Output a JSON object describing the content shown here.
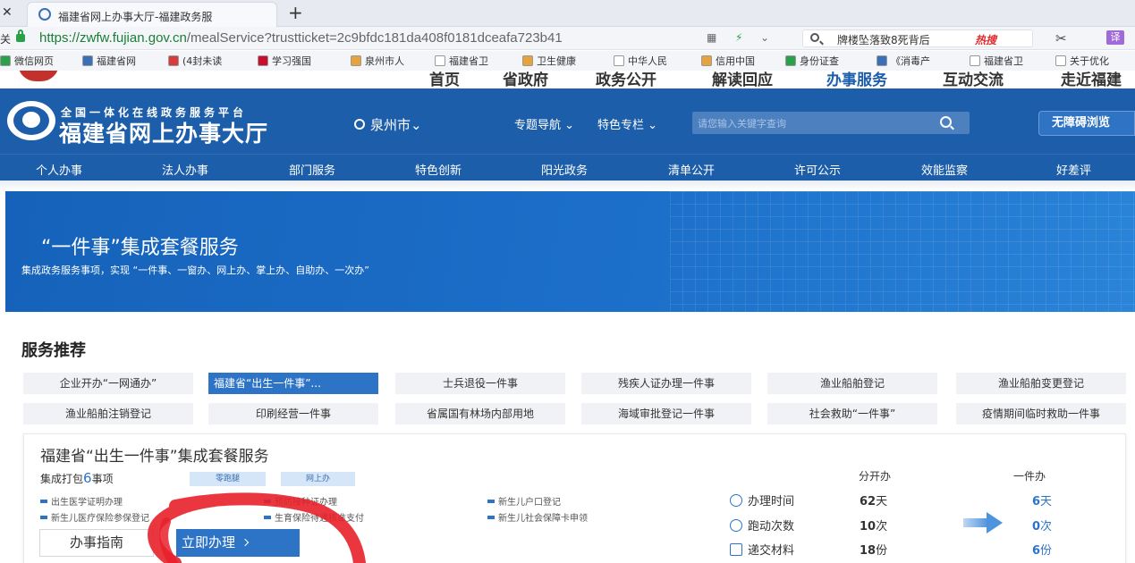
{
  "browser": {
    "tab_title": "福建省网上办事大厅-福建政务服",
    "new_tab": "+",
    "left_glyph": "关",
    "url_host": "https://zwfw.fujian.gov.cn",
    "url_path": "/mealService?trustticket=2c9bfdc181da408f0181dceafa723b41",
    "search_query": "牌楼坠落致8死背后",
    "search_hot": "热搜",
    "translate_label": "译",
    "bookmarks": [
      "微信网页",
      "福建省网",
      "(4封未读",
      "学习强国",
      "泉州市人",
      "福建省卫",
      "卫生健康",
      "中华人民",
      "信用中国",
      "身份证查",
      "《消毒产",
      "福建省卫",
      "关于优化"
    ]
  },
  "site": {
    "top_strip": [
      "首页",
      "省政府",
      "政务公开",
      "解读回应",
      "办事服务",
      "互动交流",
      "走近福建"
    ],
    "subtitle": "全国一体化在线政务服务平台",
    "title": "福建省网上办事大厅",
    "location": "泉州市",
    "topics": "专题导航",
    "features": "特色专栏",
    "search_placeholder": "请您输入关键字查询",
    "accessibility": "无障碍浏览",
    "nav": [
      "个人办事",
      "法人办事",
      "部门服务",
      "特色创新",
      "阳光政务",
      "清单公开",
      "许可公示",
      "效能监察",
      "好差评"
    ]
  },
  "banner": {
    "title": "“一件事”集成套餐服务",
    "subtitle": "集成政务服务事项，实现 “一件事、一窗办、网上办、掌上办、自助办、一次办”"
  },
  "services": {
    "heading": "服务推荐",
    "row1": [
      "企业开办“一网通办”",
      "福建省“出生一件事”...",
      "士兵退役一件事",
      "残疾人证办理一件事",
      "渔业船舶登记",
      "渔业船舶变更登记"
    ],
    "row2": [
      "渔业船舶注销登记",
      "印刷经营一件事",
      "省属国有林场内部用地",
      "海域审批登记一件事",
      "社会救助“一件事”",
      "疫情期间临时救助一件事"
    ]
  },
  "detail": {
    "title": "福建省“出生一件事”集成套餐服务",
    "pack_prefix": "集成打包",
    "pack_count": "6",
    "pack_suffix": "事项",
    "tags": [
      "零跑腿",
      "网上办"
    ],
    "items": [
      "出生医学证明办理",
      "预防接种证办理",
      "新生儿户口登记",
      "新生儿医疗保险参保登记",
      "生育保险待遇核准支付",
      "新生儿社会保障卡申领"
    ],
    "guide_button": "办事指南",
    "apply_button": "立即办理",
    "compare": {
      "head_separate": "分开办",
      "head_one": "一件办",
      "rows": [
        {
          "label": "办理时间",
          "separate_num": "62",
          "separate_unit": "天",
          "one_num": "6",
          "one_unit": "天"
        },
        {
          "label": "跑动次数",
          "separate_num": "10",
          "separate_unit": "次",
          "one_num": "0",
          "one_unit": "次"
        },
        {
          "label": "递交材料",
          "separate_num": "18",
          "separate_unit": "份",
          "one_num": "6",
          "one_unit": "份"
        }
      ]
    }
  },
  "colors": {
    "brand_blue": "#1d5eaa",
    "accent_blue": "#2e74c6",
    "annotation_red": "#e8202a"
  }
}
